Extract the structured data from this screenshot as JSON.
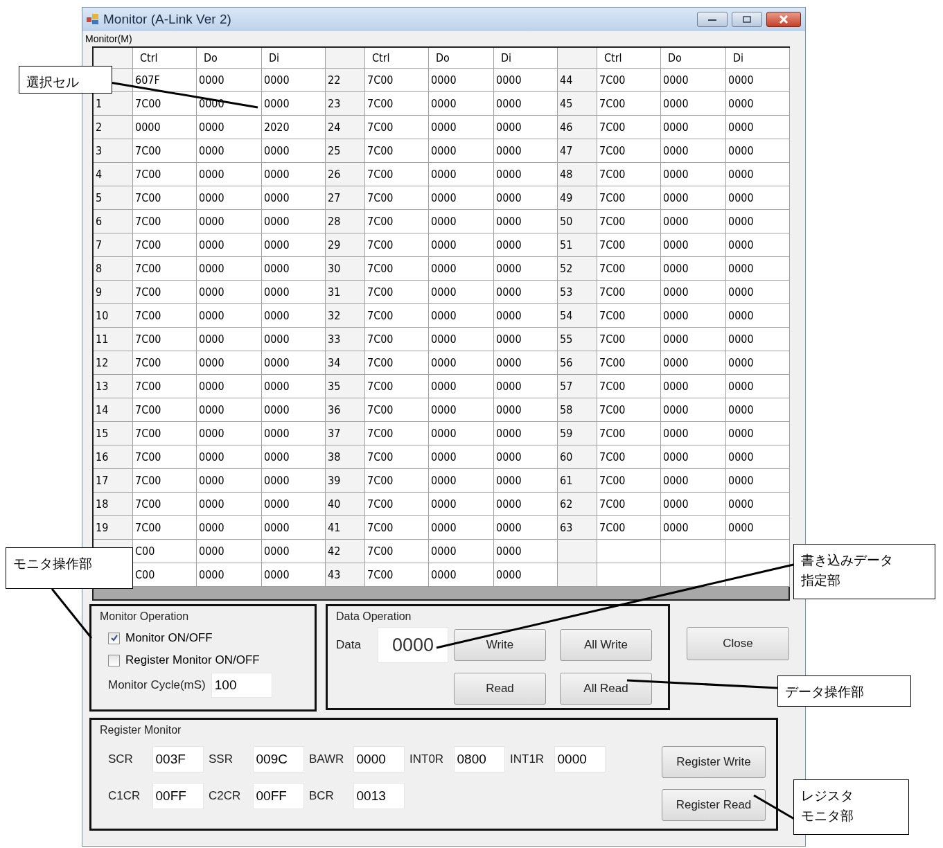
{
  "window": {
    "title": "Monitor (A-Link Ver 2)"
  },
  "menu": [
    {
      "label": "Monitor(M)"
    }
  ],
  "grid": {
    "blocks": [
      {
        "columns": [
          "Ctrl",
          "Do",
          "Di"
        ],
        "rows": [
          {
            "ctrl": "607F",
            "do": "0000",
            "di": "0000"
          },
          {
            "number": "1",
            "ctrl": "7C00",
            "do": "0000",
            "di": "0000"
          },
          {
            "number": "2",
            "ctrl": "0000",
            "do": "0000",
            "di": "2020"
          },
          {
            "number": "3",
            "ctrl": "7C00",
            "do": "0000",
            "di": "0000"
          },
          {
            "number": "4",
            "ctrl": "7C00",
            "do": "0000",
            "di": "0000"
          },
          {
            "number": "5",
            "ctrl": "7C00",
            "do": "0000",
            "di": "0000"
          },
          {
            "number": "6",
            "ctrl": "7C00",
            "do": "0000",
            "di": "0000"
          },
          {
            "number": "7",
            "ctrl": "7C00",
            "do": "0000",
            "di": "0000"
          },
          {
            "number": "8",
            "ctrl": "7C00",
            "do": "0000",
            "di": "0000"
          },
          {
            "number": "9",
            "ctrl": "7C00",
            "do": "0000",
            "di": "0000"
          },
          {
            "number": "10",
            "ctrl": "7C00",
            "do": "0000",
            "di": "0000"
          },
          {
            "number": "11",
            "ctrl": "7C00",
            "do": "0000",
            "di": "0000"
          },
          {
            "number": "12",
            "ctrl": "7C00",
            "do": "0000",
            "di": "0000"
          },
          {
            "number": "13",
            "ctrl": "7C00",
            "do": "0000",
            "di": "0000"
          },
          {
            "number": "14",
            "ctrl": "7C00",
            "do": "0000",
            "di": "0000"
          },
          {
            "number": "15",
            "ctrl": "7C00",
            "do": "0000",
            "di": "0000"
          },
          {
            "number": "16",
            "ctrl": "7C00",
            "do": "0000",
            "di": "0000"
          },
          {
            "number": "17",
            "ctrl": "7C00",
            "do": "0000",
            "di": "0000"
          },
          {
            "number": "18",
            "ctrl": "7C00",
            "do": "0000",
            "di": "0000"
          },
          {
            "number": "19",
            "ctrl": "7C00",
            "do": "0000",
            "di": "0000"
          },
          {
            "ctrl": "C00",
            "do": "0000",
            "di": "0000"
          },
          {
            "ctrl": "C00",
            "do": "0000",
            "di": "0000"
          }
        ]
      },
      {
        "columns": [
          "Ctrl",
          "Do",
          "Di"
        ],
        "rows": [
          {
            "number": "22",
            "ctrl": "7C00",
            "do": "0000",
            "di": "0000"
          },
          {
            "number": "23",
            "ctrl": "7C00",
            "do": "0000",
            "di": "0000"
          },
          {
            "number": "24",
            "ctrl": "7C00",
            "do": "0000",
            "di": "0000"
          },
          {
            "number": "25",
            "ctrl": "7C00",
            "do": "0000",
            "di": "0000"
          },
          {
            "number": "26",
            "ctrl": "7C00",
            "do": "0000",
            "di": "0000"
          },
          {
            "number": "27",
            "ctrl": "7C00",
            "do": "0000",
            "di": "0000"
          },
          {
            "number": "28",
            "ctrl": "7C00",
            "do": "0000",
            "di": "0000"
          },
          {
            "number": "29",
            "ctrl": "7C00",
            "do": "0000",
            "di": "0000"
          },
          {
            "number": "30",
            "ctrl": "7C00",
            "do": "0000",
            "di": "0000"
          },
          {
            "number": "31",
            "ctrl": "7C00",
            "do": "0000",
            "di": "0000"
          },
          {
            "number": "32",
            "ctrl": "7C00",
            "do": "0000",
            "di": "0000"
          },
          {
            "number": "33",
            "ctrl": "7C00",
            "do": "0000",
            "di": "0000"
          },
          {
            "number": "34",
            "ctrl": "7C00",
            "do": "0000",
            "di": "0000"
          },
          {
            "number": "35",
            "ctrl": "7C00",
            "do": "0000",
            "di": "0000"
          },
          {
            "number": "36",
            "ctrl": "7C00",
            "do": "0000",
            "di": "0000"
          },
          {
            "number": "37",
            "ctrl": "7C00",
            "do": "0000",
            "di": "0000"
          },
          {
            "number": "38",
            "ctrl": "7C00",
            "do": "0000",
            "di": "0000"
          },
          {
            "number": "39",
            "ctrl": "7C00",
            "do": "0000",
            "di": "0000"
          },
          {
            "number": "40",
            "ctrl": "7C00",
            "do": "0000",
            "di": "0000"
          },
          {
            "number": "41",
            "ctrl": "7C00",
            "do": "0000",
            "di": "0000"
          },
          {
            "number": "42",
            "ctrl": "7C00",
            "do": "0000",
            "di": "0000"
          },
          {
            "number": "43",
            "ctrl": "7C00",
            "do": "0000",
            "di": "0000"
          }
        ]
      },
      {
        "columns": [
          "Ctrl",
          "Do",
          "Di"
        ],
        "rows": [
          {
            "number": "44",
            "ctrl": "7C00",
            "do": "0000",
            "di": "0000"
          },
          {
            "number": "45",
            "ctrl": "7C00",
            "do": "0000",
            "di": "0000"
          },
          {
            "number": "46",
            "ctrl": "7C00",
            "do": "0000",
            "di": "0000"
          },
          {
            "number": "47",
            "ctrl": "7C00",
            "do": "0000",
            "di": "0000"
          },
          {
            "number": "48",
            "ctrl": "7C00",
            "do": "0000",
            "di": "0000"
          },
          {
            "number": "49",
            "ctrl": "7C00",
            "do": "0000",
            "di": "0000"
          },
          {
            "number": "50",
            "ctrl": "7C00",
            "do": "0000",
            "di": "0000"
          },
          {
            "number": "51",
            "ctrl": "7C00",
            "do": "0000",
            "di": "0000"
          },
          {
            "number": "52",
            "ctrl": "7C00",
            "do": "0000",
            "di": "0000"
          },
          {
            "number": "53",
            "ctrl": "7C00",
            "do": "0000",
            "di": "0000"
          },
          {
            "number": "54",
            "ctrl": "7C00",
            "do": "0000",
            "di": "0000"
          },
          {
            "number": "55",
            "ctrl": "7C00",
            "do": "0000",
            "di": "0000"
          },
          {
            "number": "56",
            "ctrl": "7C00",
            "do": "0000",
            "di": "0000"
          },
          {
            "number": "57",
            "ctrl": "7C00",
            "do": "0000",
            "di": "0000"
          },
          {
            "number": "58",
            "ctrl": "7C00",
            "do": "0000",
            "di": "0000"
          },
          {
            "number": "59",
            "ctrl": "7C00",
            "do": "0000",
            "di": "0000"
          },
          {
            "number": "60",
            "ctrl": "7C00",
            "do": "0000",
            "di": "0000"
          },
          {
            "number": "61",
            "ctrl": "7C00",
            "do": "0000",
            "di": "0000"
          },
          {
            "number": "62",
            "ctrl": "7C00",
            "do": "0000",
            "di": "0000"
          },
          {
            "number": "63",
            "ctrl": "7C00",
            "do": "0000",
            "di": "0000"
          }
        ]
      }
    ]
  },
  "monitor_operation": {
    "title": "Monitor Operation",
    "checkboxes": [
      {
        "label": "Monitor ON/OFF",
        "checked": true
      },
      {
        "label": "Register Monitor ON/OFF",
        "checked": false
      }
    ],
    "cycle": {
      "label": "Monitor Cycle(mS)",
      "value": "100"
    }
  },
  "data_operation": {
    "title": "Data Operation",
    "data": {
      "label": "Data",
      "value": "0000"
    },
    "buttons": [
      "Write",
      "All Write",
      "Read",
      "All Read"
    ]
  },
  "close_button": "Close",
  "register_monitor": {
    "title": "Register Monitor",
    "rows": [
      [
        {
          "label": "SCR",
          "value": "003F"
        },
        {
          "label": "SSR",
          "value": "009C"
        },
        {
          "label": "BAWR",
          "value": "0000"
        },
        {
          "label": "INT0R",
          "value": "0800"
        },
        {
          "label": "INT1R",
          "value": "0000"
        }
      ],
      [
        {
          "label": "C1CR",
          "value": "00FF"
        },
        {
          "label": "C2CR",
          "value": "00FF"
        },
        {
          "label": "BCR",
          "value": "0013"
        }
      ]
    ],
    "buttons": [
      "Register Write",
      "Register Read"
    ]
  },
  "annotations": [
    {
      "lines": [
        "選択セル"
      ]
    },
    {
      "lines": [
        "モニタ操作部"
      ]
    },
    {
      "lines": [
        "書き込みデータ",
        "指定部"
      ]
    },
    {
      "lines": [
        "データ操作部"
      ]
    },
    {
      "lines": [
        "レジスタ",
        "モニタ部"
      ]
    }
  ]
}
